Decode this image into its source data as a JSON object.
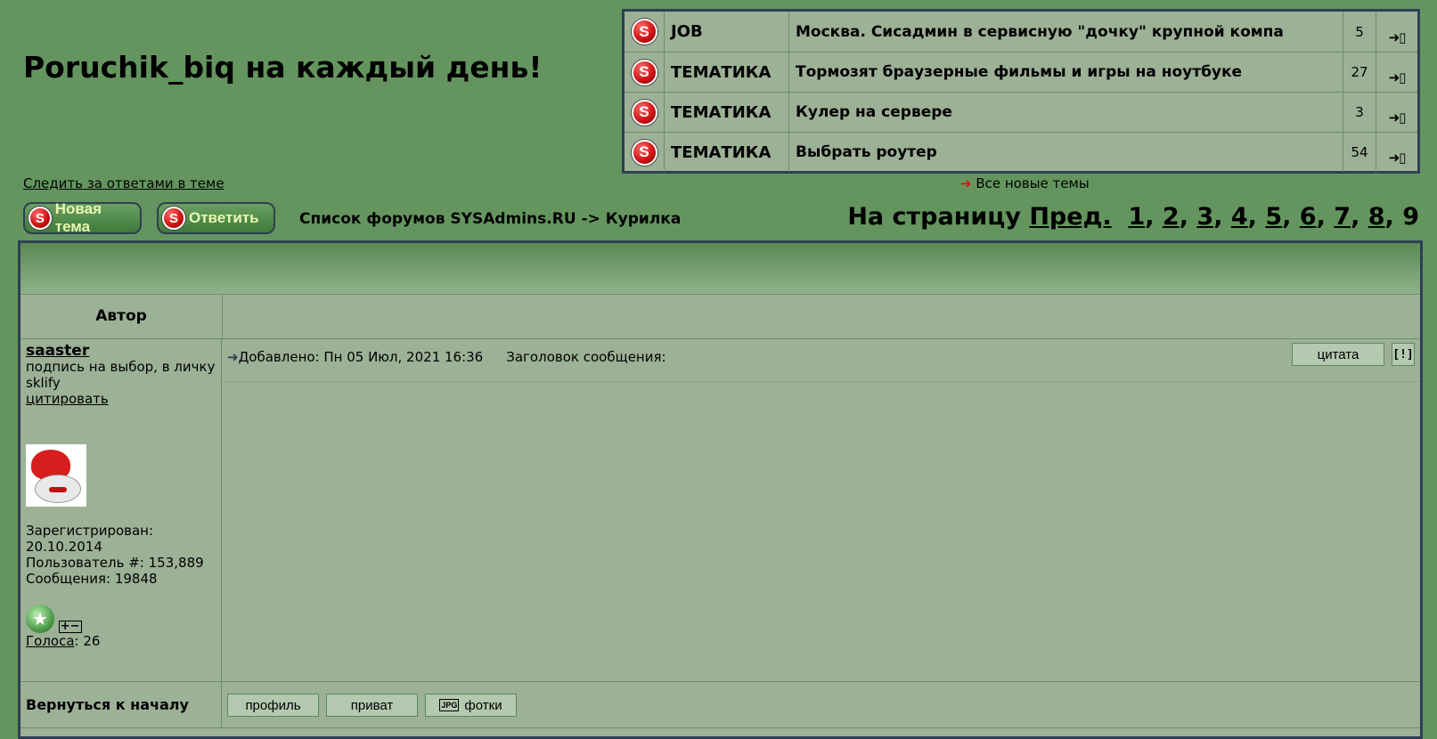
{
  "site": {
    "title": "Poruchik_biq на каждый день!"
  },
  "new_topics": [
    {
      "category": "JOB",
      "title": "Москва. Сисадмин в сервисную \"дочку\" крупной компа",
      "count": "5"
    },
    {
      "category": "ТЕМАТИКА",
      "title": "Тормозят браузерные фильмы и игры на ноутбуке",
      "count": "27"
    },
    {
      "category": "ТЕМАТИКА",
      "title": "Кулер на сервере",
      "count": "3"
    },
    {
      "category": "ТЕМАТИКА",
      "title": "Выбрать роутер",
      "count": "54"
    }
  ],
  "icons": {
    "logo": "s-logo-icon",
    "goto_new": "goto-new-post-icon",
    "arrow": "red-arrow-icon"
  },
  "links": {
    "all_new": "Все новые темы",
    "watch": "Следить за ответами в теме"
  },
  "buttons": {
    "new_topic": "Новая тема",
    "reply": "Ответить"
  },
  "breadcrumb": "Список форумов SYSAdmins.RU -> Курилка",
  "pagination": {
    "label": "На страницу",
    "prev": "Пред.",
    "pages": [
      "1",
      "2",
      "3",
      "4",
      "5",
      "6",
      "7",
      "8"
    ],
    "current": "9"
  },
  "table": {
    "author_header": "Автор"
  },
  "post": {
    "author": "saaster",
    "signature": "подпись на выбор, в личку",
    "sig2": "sklify",
    "quote_link": "цитировать",
    "registered_label": "Зарегистрирован:",
    "registered": "20.10.2014",
    "user_number": "Пользователь #: 153,889",
    "messages": "Сообщения: 19848",
    "votes_label": "Голоса",
    "votes": ": 26",
    "added": "Добавлено: Пн 05 Июл, 2021 16:36",
    "subject": "Заголовок сообщения:",
    "quote_btn": "цитата",
    "report_btn": "[!]"
  },
  "footer": {
    "back_to_top": "Вернуться к началу",
    "profile": "профиль",
    "private": "приват",
    "photos": "фотки",
    "jpg": "JPG"
  }
}
